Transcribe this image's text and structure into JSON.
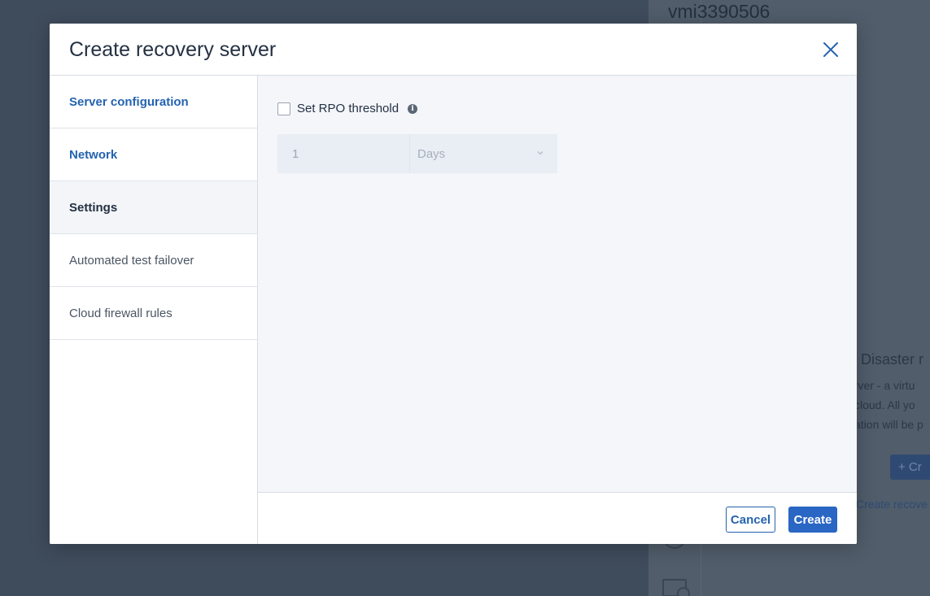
{
  "background": {
    "server_title": "vmi3390506",
    "section_heading": "Disaster r",
    "desc_lines": [
      "erver - a virtu",
      "cloud. All yo",
      "ation will be p"
    ],
    "create_button_label": "+ Cr",
    "create_link": "Create recove"
  },
  "modal": {
    "title": "Create recovery server",
    "close_icon": "close-icon"
  },
  "sidebar": {
    "items": [
      {
        "label": "Server configuration",
        "state": "link"
      },
      {
        "label": "Network",
        "state": "link"
      },
      {
        "label": "Settings",
        "state": "active"
      },
      {
        "label": "Automated test failover",
        "state": "muted"
      },
      {
        "label": "Cloud firewall rules",
        "state": "muted"
      }
    ]
  },
  "settings": {
    "rpo_checkbox_label": "Set RPO threshold",
    "rpo_checked": false,
    "info_icon": "info-icon",
    "rpo_value": "1",
    "rpo_unit": "Days"
  },
  "footer": {
    "cancel_label": "Cancel",
    "create_label": "Create"
  },
  "colors": {
    "accent": "#2a66c4",
    "link": "#2463b0",
    "overlay": "#3f4c5c"
  }
}
